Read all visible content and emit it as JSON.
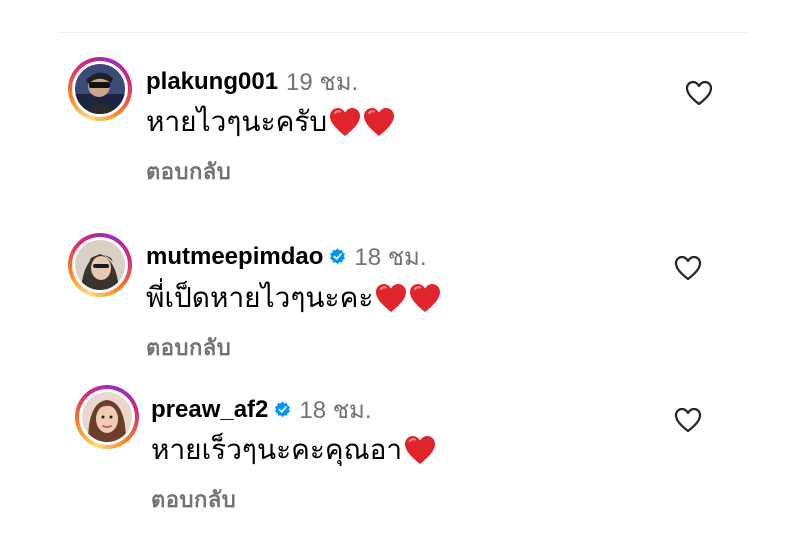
{
  "comments": [
    {
      "username": "plakung001",
      "verified": false,
      "time": "19 ชม.",
      "text": "หายไวๆนะครับ",
      "emoji": [
        "red-heart",
        "red-heart"
      ],
      "reply_label": "ตอบกลับ",
      "liked": false
    },
    {
      "username": "mutmeepimdao",
      "verified": true,
      "time": "18 ชม.",
      "text": "พี่เป็ดหายไวๆนะคะ",
      "emoji": [
        "red-heart",
        "red-heart"
      ],
      "reply_label": "ตอบกลับ",
      "liked": false
    },
    {
      "username": "preaw_af2",
      "verified": true,
      "time": "18 ชม.",
      "text": "หายเร็วๆนะคะคุณอา",
      "emoji": [
        "red-heart"
      ],
      "reply_label": "ตอบกลับ",
      "liked": false
    }
  ],
  "colors": {
    "secondary_text": "#737373",
    "verified_badge": "#0095f6",
    "heart_emoji": "#e0242b",
    "divider": "#efefef"
  }
}
